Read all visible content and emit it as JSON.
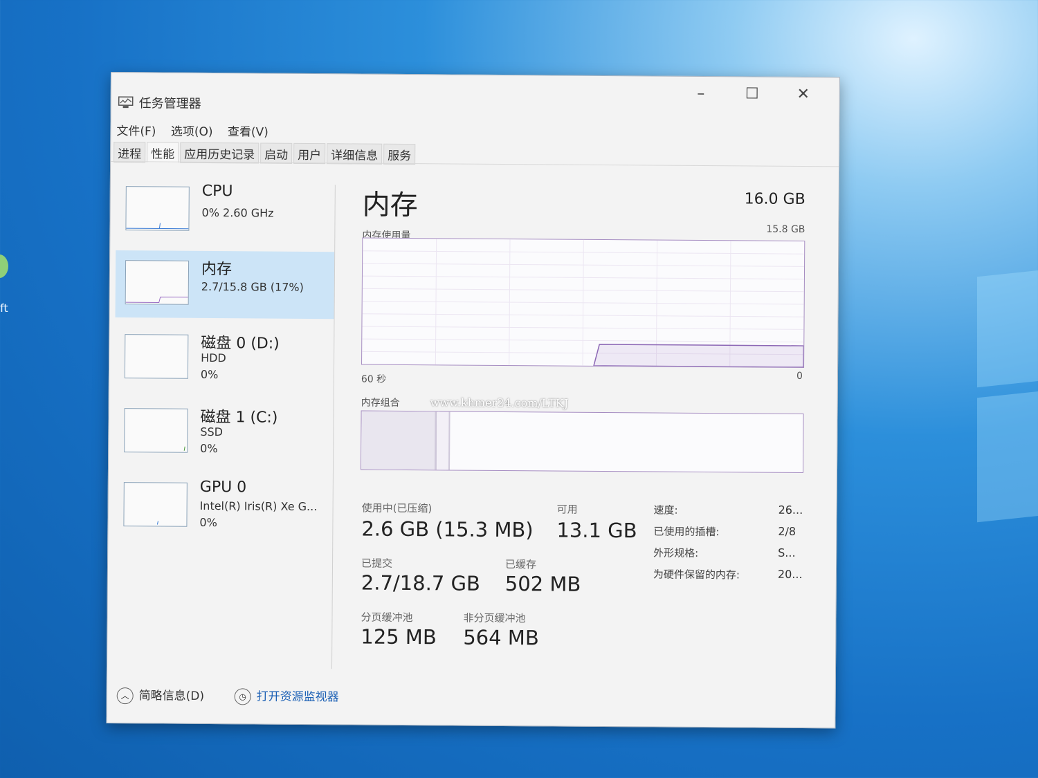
{
  "desktop": {
    "icon_label": "ft"
  },
  "window": {
    "title": "任务管理器",
    "controls": {
      "minimize": "–",
      "maximize": "☐",
      "close": "✕"
    }
  },
  "menu": {
    "file": "文件(F)",
    "options": "选项(O)",
    "view": "查看(V)"
  },
  "tabs": [
    {
      "label": "进程"
    },
    {
      "label": "性能"
    },
    {
      "label": "应用历史记录"
    },
    {
      "label": "启动"
    },
    {
      "label": "用户"
    },
    {
      "label": "详细信息"
    },
    {
      "label": "服务"
    }
  ],
  "sidebar": {
    "items": [
      {
        "name": "CPU",
        "line1": "0% 2.60 GHz",
        "line2": ""
      },
      {
        "name": "内存",
        "line1": "2.7/15.8 GB (17%)",
        "line2": ""
      },
      {
        "name": "磁盘 0 (D:)",
        "line1": "HDD",
        "line2": "0%"
      },
      {
        "name": "磁盘 1 (C:)",
        "line1": "SSD",
        "line2": "0%"
      },
      {
        "name": "GPU 0",
        "line1": "Intel(R) Iris(R) Xe G...",
        "line2": "0%"
      }
    ]
  },
  "memory": {
    "title": "内存",
    "total": "16.0 GB",
    "usage_label": "内存使用量",
    "usage_max": "15.8 GB",
    "time_left": "60 秒",
    "time_right": "0",
    "composition_label": "内存组合",
    "in_use_fraction": 0.17,
    "stats": {
      "in_use_label": "使用中(已压缩)",
      "in_use_value": "2.6 GB (15.3 MB)",
      "available_label": "可用",
      "available_value": "13.1 GB",
      "committed_label": "已提交",
      "committed_value": "2.7/18.7 GB",
      "cached_label": "已缓存",
      "cached_value": "502 MB",
      "paged_label": "分页缓冲池",
      "paged_value": "125 MB",
      "nonpaged_label": "非分页缓冲池",
      "nonpaged_value": "564 MB"
    },
    "props": {
      "speed_label": "速度:",
      "speed_value": "26...",
      "slots_label": "已使用的插槽:",
      "slots_value": "2/8",
      "form_label": "外形规格:",
      "form_value": "S...",
      "reserved_label": "为硬件保留的内存:",
      "reserved_value": "20..."
    }
  },
  "watermark": "www.khmer24.com/LTKJ",
  "footer": {
    "fewer_details": "简略信息(D)",
    "open_monitor": "打开资源监视器"
  }
}
